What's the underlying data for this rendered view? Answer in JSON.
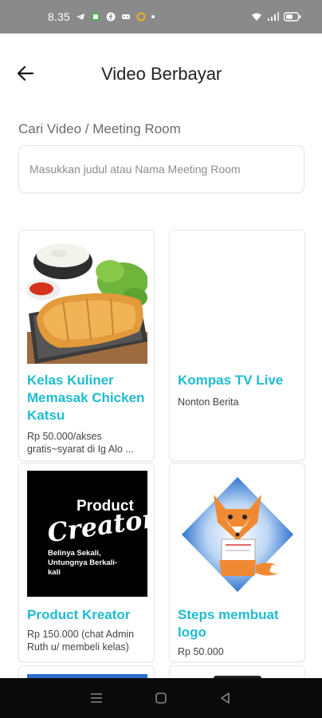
{
  "status_bar": {
    "time": "8.35"
  },
  "header": {
    "title": "Video Berbayar",
    "back_icon": "arrow-left-icon"
  },
  "search": {
    "label": "Cari Video / Meeting Room",
    "placeholder": "Masukkan judul atau Nama Meeting Room",
    "value": ""
  },
  "cards": [
    {
      "title": "Kelas Kuliner Memasak Chicken Katsu",
      "price": "Rp 50.000/akses gratis~syarat di Ig Alo ..."
    },
    {
      "title": "Kompas TV Live",
      "price": "Nonton Berita"
    },
    {
      "title": "Product Kreator",
      "price": "Rp 150.000 (chat Admin Ruth u/ membeli kelas)",
      "thumb_title": "Product",
      "thumb_script": "Creator",
      "thumb_tagline": "Belinya Sekali, Untungnya Berkali-kali"
    },
    {
      "title": "Steps membuat logo",
      "price": "Rp 50.000"
    }
  ],
  "colors": {
    "accent": "#1fbcd1",
    "status_bar": "#8a8a8a",
    "nav_bar": "#0a0a0a"
  }
}
